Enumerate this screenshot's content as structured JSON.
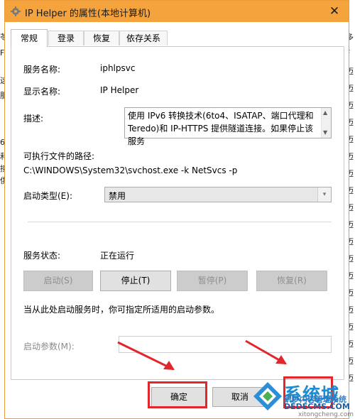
{
  "background": {
    "left_chars": [
      "苓",
      "F",
      "这",
      "服",
      "6",
      "和",
      "接",
      "供"
    ],
    "right_chars": [
      "多",
      "F",
      "迈",
      "迈",
      "迈",
      "迈",
      "迈",
      "迈",
      "迈",
      "迈",
      "迈",
      "迈",
      "迈",
      "迈",
      "迈",
      "迈",
      "迈",
      "迈",
      "迈",
      "迈",
      "迈"
    ]
  },
  "window": {
    "title": "IP Helper 的属性(本地计算机)",
    "close": "✕"
  },
  "tabs": [
    {
      "label": "常规"
    },
    {
      "label": "登录"
    },
    {
      "label": "恢复"
    },
    {
      "label": "依存关系"
    }
  ],
  "general": {
    "service_name_label": "服务名称:",
    "service_name_value": "iphlpsvc",
    "display_name_label": "显示名称:",
    "display_name_value": "IP Helper",
    "description_label": "描述:",
    "description_text": "使用 IPv6 转换技术(6to4、ISATAP、端口代理和 Teredo)和 IP-HTTPS 提供隧道连接。如果停止该服务",
    "exec_path_label": "可执行文件的路径:",
    "exec_path_value": "C:\\WINDOWS\\System32\\svchost.exe -k NetSvcs -p",
    "startup_type_label": "启动类型(E):",
    "startup_type_value": "禁用",
    "status_label": "服务状态:",
    "status_value": "正在运行",
    "btn_start": "启动(S)",
    "btn_stop": "停止(T)",
    "btn_pause": "暂停(P)",
    "btn_resume": "恢复(R)",
    "hint_text": "当从此处启动服务时，你可指定所适用的启动参数。",
    "params_label": "启动参数(M):"
  },
  "footer": {
    "ok": "确定",
    "cancel": "取消"
  },
  "watermark": {
    "big": "系统城",
    "sub1": "织梦内容管理系统",
    "sub2": "DEDECMS.COM",
    "sub3": "xitongcheng.com"
  },
  "colors": {
    "titlebar": "#f4a33d",
    "highlight": "#e3262c"
  }
}
